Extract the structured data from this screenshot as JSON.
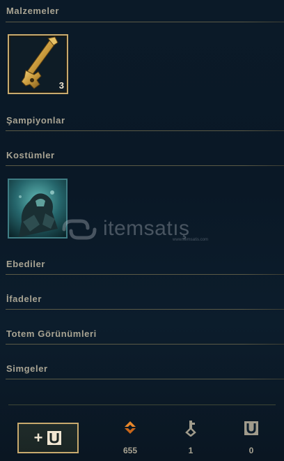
{
  "sections": [
    {
      "title": "Malzemeler"
    },
    {
      "title": "Şampiyonlar"
    },
    {
      "title": "Kostümler"
    },
    {
      "title": "Ebediler"
    },
    {
      "title": "İfadeler"
    },
    {
      "title": "Totem Görünümleri"
    },
    {
      "title": "Simgeler"
    }
  ],
  "materials": {
    "key_item": {
      "icon": "hextech-key-icon",
      "count": "3"
    }
  },
  "skins": {
    "item": {
      "icon": "champion-skin-thumbnail"
    }
  },
  "watermark": {
    "text": "itemsatış",
    "subtext": "www.itemsatis.com"
  },
  "footer": {
    "add_button": {
      "icon": "add-loot-icon",
      "plus": "+"
    },
    "currencies": [
      {
        "icon": "orange-essence-icon",
        "value": "655",
        "color": "#e8872b"
      },
      {
        "icon": "key-fragment-icon",
        "value": "1",
        "color": "#a09b8c"
      },
      {
        "icon": "chest-icon",
        "value": "0",
        "color": "#a09b8c"
      }
    ]
  }
}
